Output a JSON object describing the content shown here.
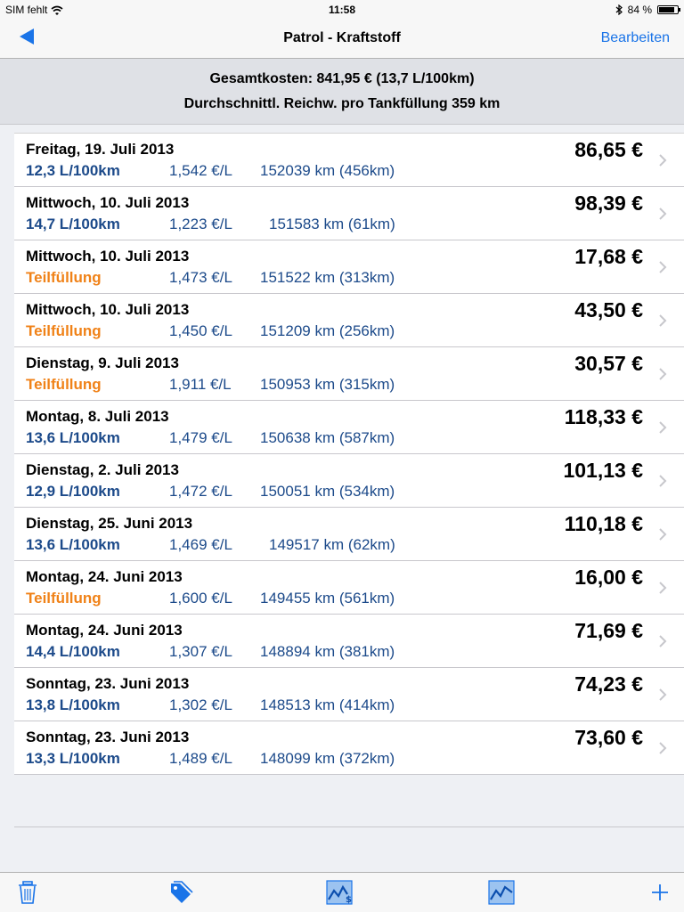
{
  "status": {
    "carrier": "SIM fehlt",
    "time": "11:58",
    "battery": "84 %",
    "battery_level": 0.84
  },
  "nav": {
    "title": "Patrol - Kraftstoff",
    "edit_label": "Bearbeiten"
  },
  "summary": {
    "line1": "Gesamtkosten: 841,95 €  (13,7 L/100km)",
    "line2": "Durchschnittl. Reichw. pro Tankfüllung 359 km"
  },
  "entries": [
    {
      "date": "Freitag, 19. Juli 2013",
      "consumption": "12,3 L/100km",
      "price": "1,542 €/L",
      "km": "152039 km (456km)",
      "cost": "86,65 €",
      "partial": false
    },
    {
      "date": "Mittwoch, 10. Juli 2013",
      "consumption": "14,7 L/100km",
      "price": "1,223 €/L",
      "km": "151583 km (61km)",
      "cost": "98,39 €",
      "partial": false
    },
    {
      "date": "Mittwoch, 10. Juli 2013",
      "consumption": "Teilfüllung",
      "price": "1,473 €/L",
      "km": "151522 km (313km)",
      "cost": "17,68 €",
      "partial": true
    },
    {
      "date": "Mittwoch, 10. Juli 2013",
      "consumption": "Teilfüllung",
      "price": "1,450 €/L",
      "km": "151209 km (256km)",
      "cost": "43,50 €",
      "partial": true
    },
    {
      "date": "Dienstag, 9. Juli 2013",
      "consumption": "Teilfüllung",
      "price": "1,911 €/L",
      "km": "150953 km (315km)",
      "cost": "30,57 €",
      "partial": true
    },
    {
      "date": "Montag, 8. Juli 2013",
      "consumption": "13,6 L/100km",
      "price": "1,479 €/L",
      "km": "150638 km (587km)",
      "cost": "118,33 €",
      "partial": false
    },
    {
      "date": "Dienstag, 2. Juli 2013",
      "consumption": "12,9 L/100km",
      "price": "1,472 €/L",
      "km": "150051 km (534km)",
      "cost": "101,13 €",
      "partial": false
    },
    {
      "date": "Dienstag, 25. Juni 2013",
      "consumption": "13,6 L/100km",
      "price": "1,469 €/L",
      "km": "149517 km (62km)",
      "cost": "110,18 €",
      "partial": false
    },
    {
      "date": "Montag, 24. Juni 2013",
      "consumption": "Teilfüllung",
      "price": "1,600 €/L",
      "km": "149455 km (561km)",
      "cost": "16,00 €",
      "partial": true
    },
    {
      "date": "Montag, 24. Juni 2013",
      "consumption": "14,4 L/100km",
      "price": "1,307 €/L",
      "km": "148894 km (381km)",
      "cost": "71,69 €",
      "partial": false
    },
    {
      "date": "Sonntag, 23. Juni 2013",
      "consumption": "13,8 L/100km",
      "price": "1,302 €/L",
      "km": "148513 km (414km)",
      "cost": "74,23 €",
      "partial": false
    },
    {
      "date": "Sonntag, 23. Juni 2013",
      "consumption": "13,3 L/100km",
      "price": "1,489 €/L",
      "km": "148099 km (372km)",
      "cost": "73,60 €",
      "partial": false
    }
  ],
  "toolbar": {
    "items": [
      "trash-icon",
      "tag-icon",
      "cost-chart-icon",
      "consumption-chart-icon",
      "add-icon"
    ]
  },
  "colors": {
    "accent": "#1a74e8",
    "value_blue": "#1c4a8a",
    "partial_orange": "#f08218"
  }
}
